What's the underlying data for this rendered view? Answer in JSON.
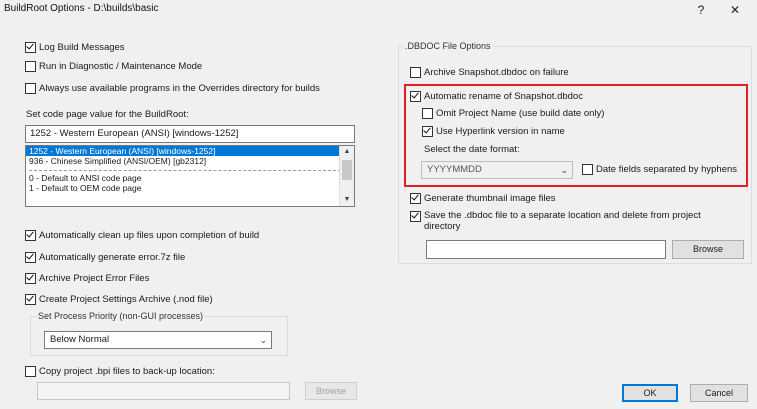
{
  "window": {
    "title": "BuildRoot Options - D:\\builds\\basic",
    "help_glyph": "?",
    "close_glyph": "✕"
  },
  "left": {
    "log_build_messages": {
      "label": "Log Build Messages",
      "checked": true
    },
    "run_diagnostic": {
      "label": "Run in Diagnostic / Maintenance Mode",
      "checked": false
    },
    "always_use_overrides": {
      "label": "Always use available programs in the Overrides directory for builds",
      "checked": false
    },
    "code_page_label": "Set code page value for the BuildRoot:",
    "code_page_value": "1252 - Western European (ANSI) [windows-1252]",
    "code_page_list": [
      {
        "text": "1252 - Western European (ANSI) [windows-1252]",
        "selected": true
      },
      {
        "text": "936 - Chinese Simplified (ANSI/OEM) [gb2312]",
        "selected": false
      },
      {
        "text": "0 - Default to ANSI code page",
        "selected": false
      },
      {
        "text": "1 - Default to OEM code page",
        "selected": false
      }
    ],
    "auto_clean_up": {
      "label": "Automatically clean up files upon completion of build",
      "checked": true
    },
    "auto_generate_error": {
      "label": "Automatically generate error.7z file",
      "checked": true
    },
    "archive_project_errors": {
      "label": "Archive Project Error Files",
      "checked": true
    },
    "create_settings_archive": {
      "label": "Create Project Settings Archive (.nod file)",
      "checked": true
    },
    "priority_group_label": "Set Process Priority (non-GUI processes)",
    "priority_value": "Below Normal",
    "copy_bpi": {
      "label": "Copy project .bpi files to back-up location:",
      "checked": false
    },
    "copy_bpi_path": "",
    "browse_label": "Browse"
  },
  "right": {
    "group_label": ".DBDOC File Options",
    "archive_snapshot": {
      "label": "Archive Snapshot.dbdoc on failure",
      "checked": false
    },
    "auto_rename": {
      "label": "Automatic rename of Snapshot.dbdoc",
      "checked": true
    },
    "omit_project_name": {
      "label": "Omit Project Name (use build date only)",
      "checked": false
    },
    "use_hyperlink_version": {
      "label": "Use Hyperlink version in name",
      "checked": true
    },
    "date_format_label": "Select the date format:",
    "date_format_value": "YYYYMMDD",
    "date_separated": {
      "label": "Date fields separated by hyphens",
      "checked": false
    },
    "generate_thumbnails": {
      "label": "Generate thumbnail image files",
      "checked": true
    },
    "save_separate": {
      "label": "Save the .dbdoc file to a separate location and delete from project directory",
      "checked": true
    },
    "save_path": "",
    "browse_label": "Browse"
  },
  "footer": {
    "ok_label": "OK",
    "cancel_label": "Cancel"
  },
  "colors": {
    "highlight": "#e21f26",
    "selection": "#0078d7"
  }
}
